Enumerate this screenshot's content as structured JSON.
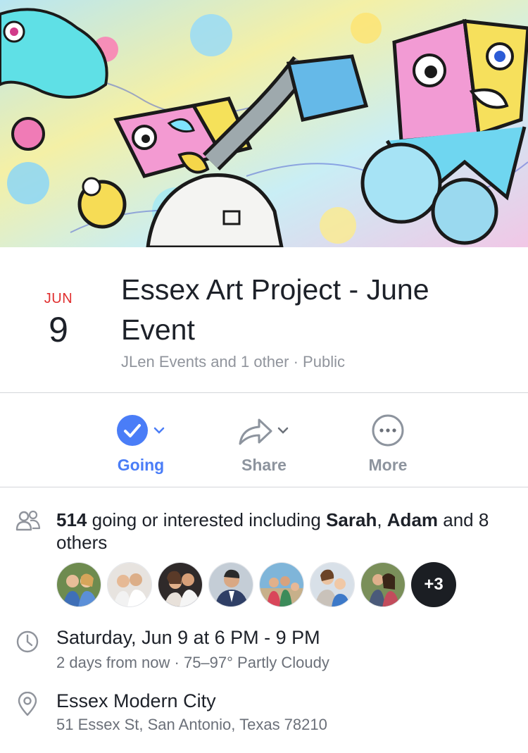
{
  "event": {
    "month": "JUN",
    "day": "9",
    "title": "Essex Art Project - June Event",
    "host_line": "JLen Events and 1 other · Public"
  },
  "actions": [
    {
      "label": "Going",
      "icon": "check-circle-icon"
    },
    {
      "label": "Share",
      "icon": "share-arrow-icon"
    },
    {
      "label": "More",
      "icon": "more-dots-icon"
    }
  ],
  "attendance": {
    "count": "514",
    "text_mid": " going or interested including ",
    "friend1": "Sarah",
    "sep": ", ",
    "friend2": "Adam",
    "text_end": " and 8 others",
    "more_count": "+3"
  },
  "time": {
    "primary": "Saturday, Jun 9 at 6 PM - 9 PM",
    "secondary": "2 days from now · 75–97° Partly Cloudy"
  },
  "location": {
    "name": "Essex Modern City",
    "address": "51 Essex St, San Antonio, Texas 78210"
  },
  "colors": {
    "accent": "#4a7df7",
    "date_red": "#e02f2f",
    "muted": "#8d949e"
  }
}
